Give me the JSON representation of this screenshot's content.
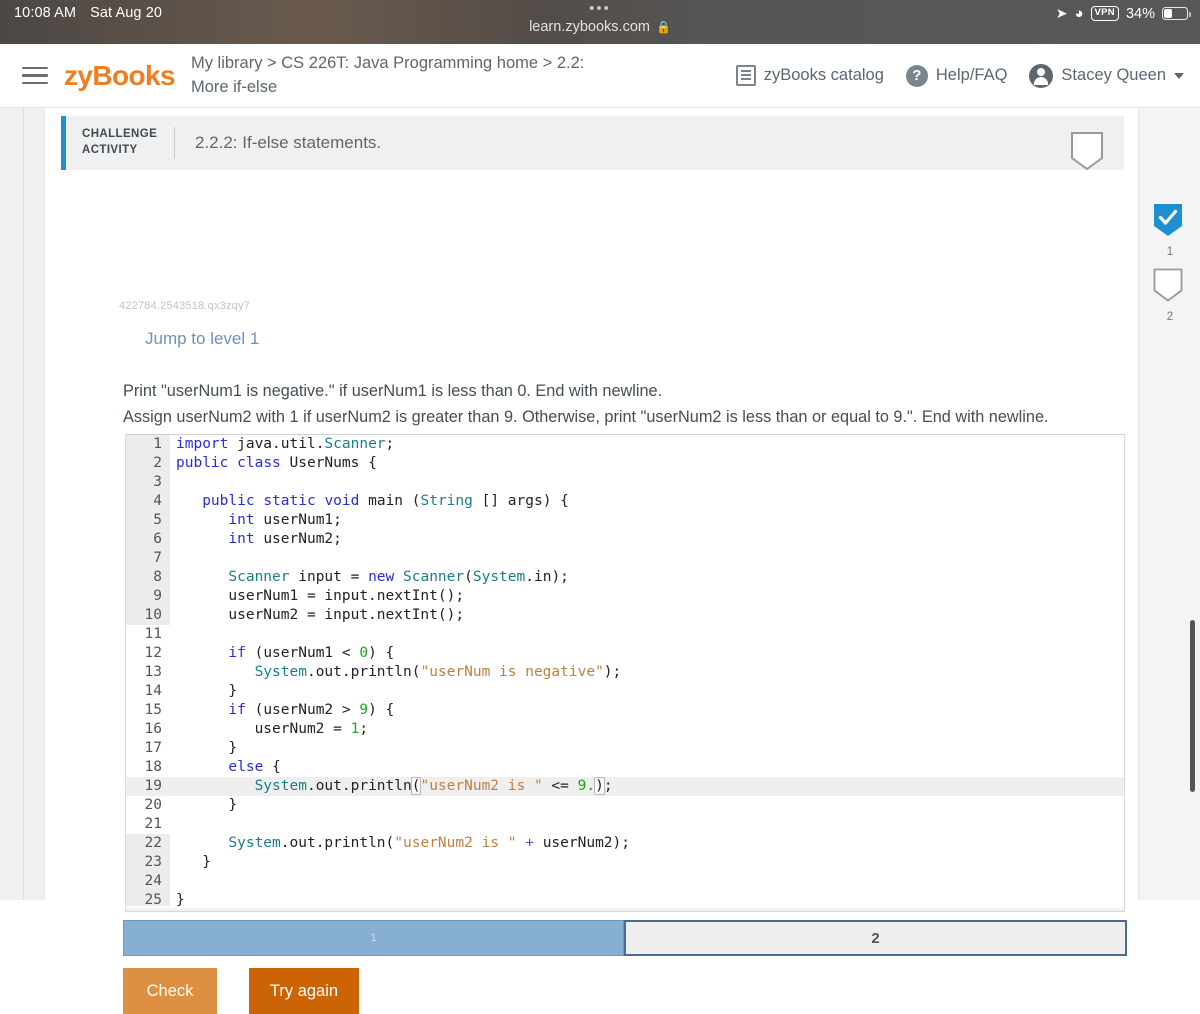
{
  "status_bar": {
    "time": "10:08 AM",
    "date": "Sat Aug 20",
    "location_icon": "location-arrow-icon",
    "wifi_icon": "wifi-icon",
    "vpn_label": "VPN",
    "battery_percent": "34%"
  },
  "browser": {
    "tabs_dots": "•••",
    "url": "learn.zybooks.com",
    "lock_icon": "lock-icon"
  },
  "header": {
    "menu_icon": "hamburger-menu-icon",
    "logo": "zyBooks",
    "breadcrumb": "My library > CS 226T: Java Programming home > 2.2: More if-else",
    "catalog_label": "zyBooks catalog",
    "catalog_icon": "book-catalog-icon",
    "help_label": "Help/FAQ",
    "help_icon": "question-mark-icon",
    "user_name": "Stacey Queen",
    "user_icon": "user-avatar-icon",
    "caret_icon": "chevron-down-icon"
  },
  "challenge": {
    "kicker_line1": "CHALLENGE",
    "kicker_line2": "ACTIVITY",
    "title": "2.2.2: If-else statements.",
    "activity_id": "422784.2543518.qx3zqy7",
    "jump_link": "Jump to level 1"
  },
  "instructions": [
    "Print \"userNum1 is negative.\" if userNum1 is less than 0. End with newline.",
    "Assign userNum2 with 1 if userNum2 is greater than 9. Otherwise, print \"userNum2 is less than or equal to 9.\". End with newline."
  ],
  "progress": {
    "badge_header": {
      "icon": "shield-outline-icon",
      "state": "empty",
      "label": ""
    },
    "badges": [
      {
        "icon": "shield-check-icon",
        "state": "complete",
        "label": "1",
        "color": "#1e90d2"
      },
      {
        "icon": "shield-outline-icon",
        "state": "empty",
        "label": "2",
        "color": "#8a8a8a"
      }
    ]
  },
  "editor": {
    "language": "java",
    "active_line": 19,
    "readonly_ranges": [
      [
        1,
        10
      ],
      [
        22,
        25
      ]
    ],
    "lines": [
      {
        "n": 1,
        "ro": true,
        "code": "import java.util.Scanner;"
      },
      {
        "n": 2,
        "ro": true,
        "code": "public class UserNums {"
      },
      {
        "n": 3,
        "ro": true,
        "code": ""
      },
      {
        "n": 4,
        "ro": true,
        "code": "   public static void main (String [] args) {"
      },
      {
        "n": 5,
        "ro": true,
        "code": "      int userNum1;"
      },
      {
        "n": 6,
        "ro": true,
        "code": "      int userNum2;"
      },
      {
        "n": 7,
        "ro": true,
        "code": ""
      },
      {
        "n": 8,
        "ro": true,
        "code": "      Scanner input = new Scanner(System.in);"
      },
      {
        "n": 9,
        "ro": true,
        "code": "      userNum1 = input.nextInt();"
      },
      {
        "n": 10,
        "ro": true,
        "code": "      userNum2 = input.nextInt();"
      },
      {
        "n": 11,
        "ro": false,
        "code": ""
      },
      {
        "n": 12,
        "ro": false,
        "code": "      if (userNum1 < 0) {"
      },
      {
        "n": 13,
        "ro": false,
        "code": "         System.out.println(\"userNum is negative\");"
      },
      {
        "n": 14,
        "ro": false,
        "code": "      }"
      },
      {
        "n": 15,
        "ro": false,
        "code": "      if (userNum2 > 9) {"
      },
      {
        "n": 16,
        "ro": false,
        "code": "         userNum2 = 1;"
      },
      {
        "n": 17,
        "ro": false,
        "code": "      }"
      },
      {
        "n": 18,
        "ro": false,
        "code": "      else {"
      },
      {
        "n": 19,
        "ro": false,
        "code": "         System.out.println(\"userNum2 is \" <= 9.);"
      },
      {
        "n": 20,
        "ro": false,
        "code": "      }"
      },
      {
        "n": 21,
        "ro": false,
        "code": ""
      },
      {
        "n": 22,
        "ro": true,
        "code": "      System.out.println(\"userNum2 is \" + userNum2);"
      },
      {
        "n": 23,
        "ro": true,
        "code": "   }"
      },
      {
        "n": 24,
        "ro": true,
        "code": ""
      },
      {
        "n": 25,
        "ro": true,
        "code": "}"
      }
    ]
  },
  "level_tabs": [
    {
      "label": "1",
      "state": "completed"
    },
    {
      "label": "2",
      "state": "current"
    }
  ],
  "buttons": {
    "check": "Check",
    "try_again": "Try again"
  },
  "colors": {
    "brand_orange": "#f07d20",
    "accent_blue": "#1e90d2",
    "check_button": "#dd9042",
    "try_again_button": "#cc6405",
    "tab_completed": "#87afd2",
    "tab_current_border": "#4a6b94"
  }
}
